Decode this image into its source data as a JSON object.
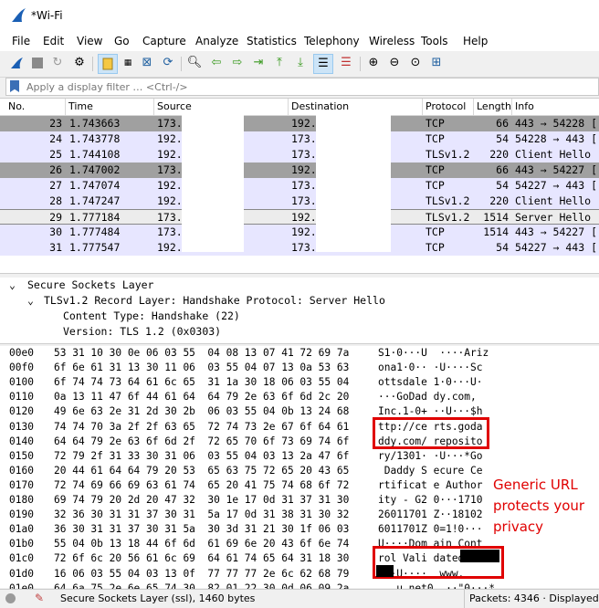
{
  "window": {
    "title": "*Wi-Fi"
  },
  "menu": [
    "File",
    "Edit",
    "View",
    "Go",
    "Capture",
    "Analyze",
    "Statistics",
    "Telephony",
    "Wireless",
    "Tools",
    "Help"
  ],
  "toolbar": {
    "icons": [
      "shark-fin-start-icon",
      "stop-icon",
      "restart-icon",
      "options-gear-icon",
      "open-file-icon",
      "file-binary-icon",
      "close-file-icon",
      "reload-icon",
      "find-icon",
      "go-back-icon",
      "go-forward-icon",
      "go-to-packet-icon",
      "first-packet-icon",
      "last-packet-icon",
      "autoscroll-icon",
      "colorize-icon",
      "zoom-in-icon",
      "zoom-out-icon",
      "zoom-normal-icon",
      "resize-columns-icon"
    ]
  },
  "filter": {
    "placeholder": "Apply a display filter … <Ctrl-/>"
  },
  "packet_list": {
    "columns": [
      "No.",
      "Time",
      "Source",
      "Destination",
      "Protocol",
      "Length",
      "Info"
    ],
    "rows": [
      {
        "no": "23",
        "time": "1.743663",
        "src": "173.",
        "dst": "192.",
        "proto": "TCP",
        "len": "66",
        "info": "443 → 54228 [",
        "style": "sel"
      },
      {
        "no": "24",
        "time": "1.743778",
        "src": "192.",
        "dst": "173.",
        "proto": "TCP",
        "len": "54",
        "info": "54228 → 443 [",
        "style": "lav"
      },
      {
        "no": "25",
        "time": "1.744108",
        "src": "192.",
        "dst": "173.",
        "proto": "TLSv1.2",
        "len": "220",
        "info": "Client Hello",
        "style": "lav"
      },
      {
        "no": "26",
        "time": "1.747002",
        "src": "173.",
        "dst": "192.",
        "proto": "TCP",
        "len": "66",
        "info": "443 → 54227 [",
        "style": "sel"
      },
      {
        "no": "27",
        "time": "1.747074",
        "src": "192.",
        "dst": "173.",
        "proto": "TCP",
        "len": "54",
        "info": "54227 → 443 [",
        "style": "lav"
      },
      {
        "no": "28",
        "time": "1.747247",
        "src": "192.",
        "dst": "173.",
        "proto": "TLSv1.2",
        "len": "220",
        "info": "Client Hello",
        "style": "lav"
      },
      {
        "no": "29",
        "time": "1.777184",
        "src": "173.",
        "dst": "192.",
        "proto": "TLSv1.2",
        "len": "1514",
        "info": "Server Hello",
        "style": "cur"
      },
      {
        "no": "30",
        "time": "1.777484",
        "src": "173.",
        "dst": "192.",
        "proto": "TCP",
        "len": "1514",
        "info": "443 → 54227 [",
        "style": "lav"
      },
      {
        "no": "31",
        "time": "1.777547",
        "src": "192.",
        "dst": "173.",
        "proto": "TCP",
        "len": "54",
        "info": "54227 → 443 [",
        "style": "lav"
      }
    ]
  },
  "detail": {
    "lines": [
      {
        "text": "Secure Sockets Layer",
        "indent": 0,
        "toggle": "⌄"
      },
      {
        "text": "TLSv1.2 Record Layer: Handshake Protocol: Server Hello",
        "indent": 1,
        "toggle": "⌄"
      },
      {
        "text": "Content Type: Handshake (22)",
        "indent": 2,
        "toggle": ""
      },
      {
        "text": "Version: TLS 1.2 (0x0303)",
        "indent": 2,
        "toggle": ""
      }
    ]
  },
  "bytes": {
    "rows": [
      {
        "off": "00e0",
        "hex": "53 31 10 30 0e 06 03 55  04 08 13 07 41 72 69 7a",
        "ascii": "S1·0···U  ····Ariz"
      },
      {
        "off": "00f0",
        "hex": "6f 6e 61 31 13 30 11 06  03 55 04 07 13 0a 53 63",
        "ascii": "ona1·0·· ·U····Sc"
      },
      {
        "off": "0100",
        "hex": "6f 74 74 73 64 61 6c 65  31 1a 30 18 06 03 55 04",
        "ascii": "ottsdale 1·0···U·"
      },
      {
        "off": "0110",
        "hex": "0a 13 11 47 6f 44 61 64  64 79 2e 63 6f 6d 2c 20",
        "ascii": "···GoDad dy.com,"
      },
      {
        "off": "0120",
        "hex": "49 6e 63 2e 31 2d 30 2b  06 03 55 04 0b 13 24 68",
        "ascii": "Inc.1-0+ ··U···$h"
      },
      {
        "off": "0130",
        "hex": "74 74 70 3a 2f 2f 63 65  72 74 73 2e 67 6f 64 61",
        "ascii": "ttp://ce rts.goda"
      },
      {
        "off": "0140",
        "hex": "64 64 79 2e 63 6f 6d 2f  72 65 70 6f 73 69 74 6f",
        "ascii": "ddy.com/ reposito"
      },
      {
        "off": "0150",
        "hex": "72 79 2f 31 33 30 31 06  03 55 04 03 13 2a 47 6f",
        "ascii": "ry/1301· ·U···*Go"
      },
      {
        "off": "0160",
        "hex": "20 44 61 64 64 79 20 53  65 63 75 72 65 20 43 65",
        "ascii": " Daddy S ecure Ce"
      },
      {
        "off": "0170",
        "hex": "72 74 69 66 69 63 61 74  65 20 41 75 74 68 6f 72",
        "ascii": "rtificat e Author"
      },
      {
        "off": "0180",
        "hex": "69 74 79 20 2d 20 47 32  30 1e 17 0d 31 37 31 30",
        "ascii": "ity - G2 0···1710"
      },
      {
        "off": "0190",
        "hex": "32 36 30 31 31 37 30 31  5a 17 0d 31 38 31 30 32",
        "ascii": "26011701 Z··18102"
      },
      {
        "off": "01a0",
        "hex": "36 30 31 31 37 30 31 5a  30 3d 31 21 30 1f 06 03",
        "ascii": "6011701Z 0=1!0···"
      },
      {
        "off": "01b0",
        "hex": "55 04 0b 13 18 44 6f 6d  61 69 6e 20 43 6f 6e 74",
        "ascii": "U····Dom ain Cont"
      },
      {
        "off": "01c0",
        "hex": "72 6f 6c 20 56 61 6c 69  64 61 74 65 64 31 18 30",
        "ascii": "rol Vali dated1·0"
      },
      {
        "off": "01d0",
        "hex": "16 06 03 55 04 03 13 0f  77 77 77 2e 6c 62 68 79",
        "ascii": "···U····  www."
      },
      {
        "off": "01e0",
        "hex": "64 6a 75 2e 6e 65 74 30  82 01 22 30 0d 06 09 2a",
        "ascii": "   u.net0  ··\"0···*"
      }
    ]
  },
  "annotation": {
    "lines": [
      "Generic URL",
      "protects your",
      "privacy"
    ],
    "color": "#e00000"
  },
  "status": {
    "text": "Secure Sockets Layer (ssl), 1460 bytes",
    "packets": "Packets: 4346 · Displayed: 43"
  }
}
